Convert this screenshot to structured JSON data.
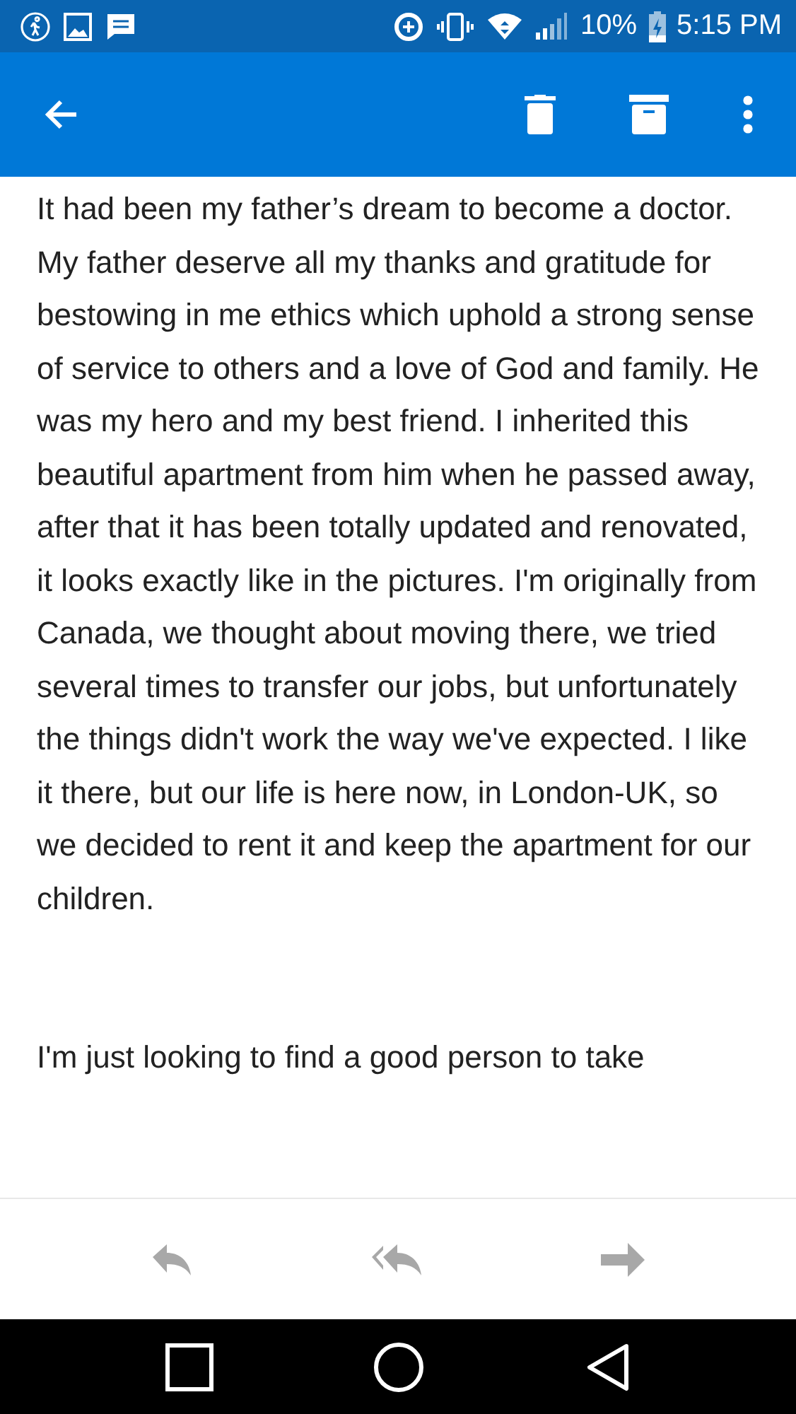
{
  "status_bar": {
    "battery": "10%",
    "time": "5:15 PM"
  },
  "message": {
    "paragraphs": [
      "It had been my father’s dream to become a doctor. My father deserve all my thanks and gratitude for bestowing in me ethics which uphold a strong sense of service to others and a love of God and family. He was my hero and my best friend. I inherited this beautiful apartment from him when he passed away, after that it has been totally updated and renovated, it looks exactly like in the pictures. I'm originally from Canada, we thought about moving there, we tried several times to transfer our jobs, but unfortunately the things didn't work the way we've expected. I like it there, but our life is here now, in London-UK, so we decided to rent it and keep the apartment for our children.",
      "I'm just looking to find a good person to take"
    ]
  }
}
